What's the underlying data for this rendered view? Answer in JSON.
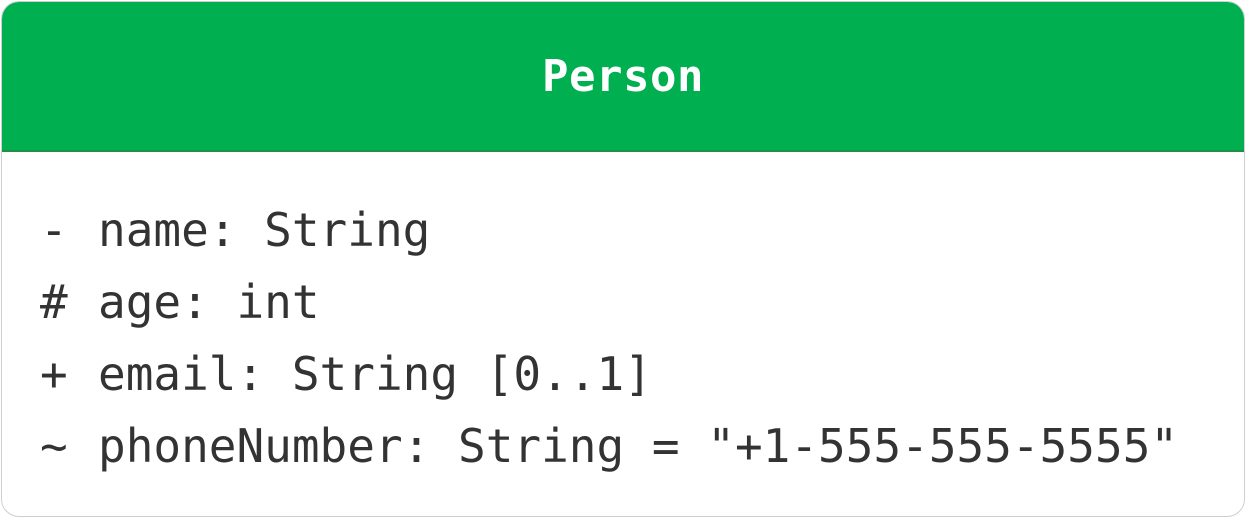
{
  "class": {
    "name": "Person",
    "header_color": "#00b050",
    "attributes": [
      {
        "visibility": "-",
        "text": "name: String"
      },
      {
        "visibility": "#",
        "text": "age: int"
      },
      {
        "visibility": "+",
        "text": "email: String [0..1]"
      },
      {
        "visibility": "~",
        "text": "phoneNumber: String = \"+1-555-555-5555\""
      }
    ]
  }
}
